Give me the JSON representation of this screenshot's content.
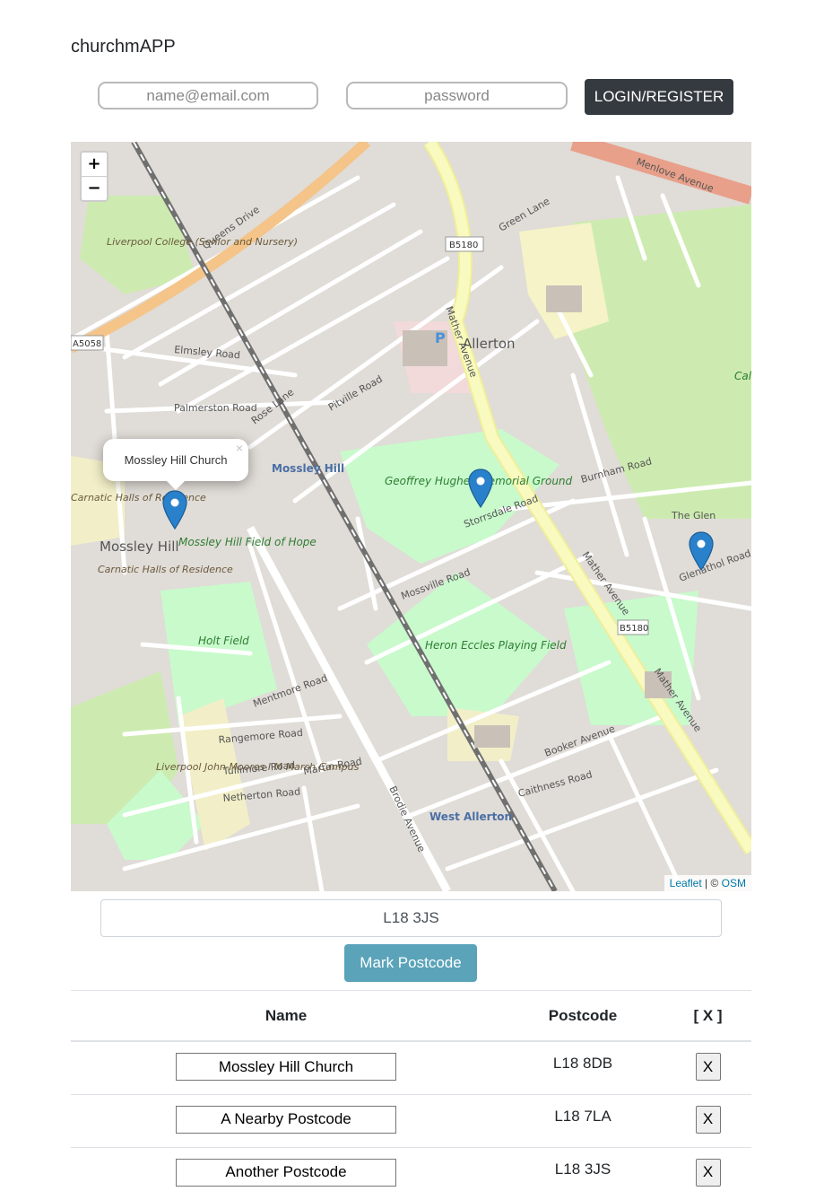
{
  "header": {
    "brand": "churchmAPP"
  },
  "auth": {
    "email_placeholder": "name@email.com",
    "password_placeholder": "password",
    "login_label": "LOGIN/REGISTER"
  },
  "map": {
    "zoom_in": "+",
    "zoom_out": "−",
    "popup_text": "Mossley Hill Church",
    "popup_close": "×",
    "attribution": {
      "leaflet": "Leaflet",
      "separator": " | © ",
      "osm": "OSM"
    },
    "labels": {
      "queens_drive": "Queens Drive",
      "menlove_avenue": "Menlove Avenue",
      "mather_avenue": "Mather Avenue",
      "mather_avenue_2": "Mather Avenue",
      "mather_avenue_3": "Mather Avenue",
      "allerton": "Allerton",
      "mossley_hill": "Mossley Hill",
      "mossley_hill_station": "Mossley Hill",
      "west_allerton": "West Allerton",
      "b5180": "B5180",
      "b5180_2": "B5180",
      "a5058": "A5058",
      "liverpool_college": "Liverpool College (Senior and Nursery)",
      "geoffrey_hughes": "Geoffrey Hughes Memorial Ground",
      "heron_eccles": "Heron Eccles Playing Field",
      "holt_field": "Holt Field",
      "mossley_hill_field": "Mossley Hill Field of Hope",
      "carnatic_halls": "Carnatic Halls of Residence",
      "carnatic_halls_2": "Carnatic Halls of Residence",
      "ljmu_campus": "Liverpool John Moores I M Marsh Campus",
      "calderstones": "Calde Pa",
      "rose_lane": "Rose Lane",
      "storrsdale_road": "Storrsdale Road",
      "mossville_road": "Mossville Road",
      "booker_avenue": "Booker Avenue",
      "elmsley_road": "Elmsley Road",
      "palmerston_road": "Palmerston Road",
      "pitville_road": "Pitville Road",
      "menlove_gardens": "Green Lane",
      "brodie_avenue": "Brodie Avenue",
      "caithness_road": "Caithness Road",
      "rangemore_road": "Rangemore Road",
      "tullimore_road": "Tullimore Road",
      "netherton_road": "Netherton Road",
      "martin_road": "Martin Road",
      "mentmore_road": "Mentmore Road",
      "glenathol_road": "Glenathol Road",
      "burnham_road": "Burnham Road",
      "the_glen": "The Glen",
      "parking": "P"
    }
  },
  "postcode_form": {
    "value": "L18 3JS",
    "button_label": "Mark Postcode"
  },
  "table": {
    "headers": {
      "name": "Name",
      "postcode": "Postcode",
      "delete": "[ X ]"
    },
    "rows": [
      {
        "name": "Mossley Hill Church",
        "postcode": "L18 8DB",
        "delete": "X"
      },
      {
        "name": "A Nearby Postcode",
        "postcode": "L18 7LA",
        "delete": "X"
      },
      {
        "name": "Another Postcode",
        "postcode": "L18 3JS",
        "delete": "X"
      }
    ]
  },
  "colors": {
    "login_button": "#343a40",
    "mark_button": "#5aa3b9",
    "marker": "#2a81cb",
    "park": "#c8facc",
    "major_road": "#f8fabf",
    "trunk_road": "#e8a08a"
  }
}
